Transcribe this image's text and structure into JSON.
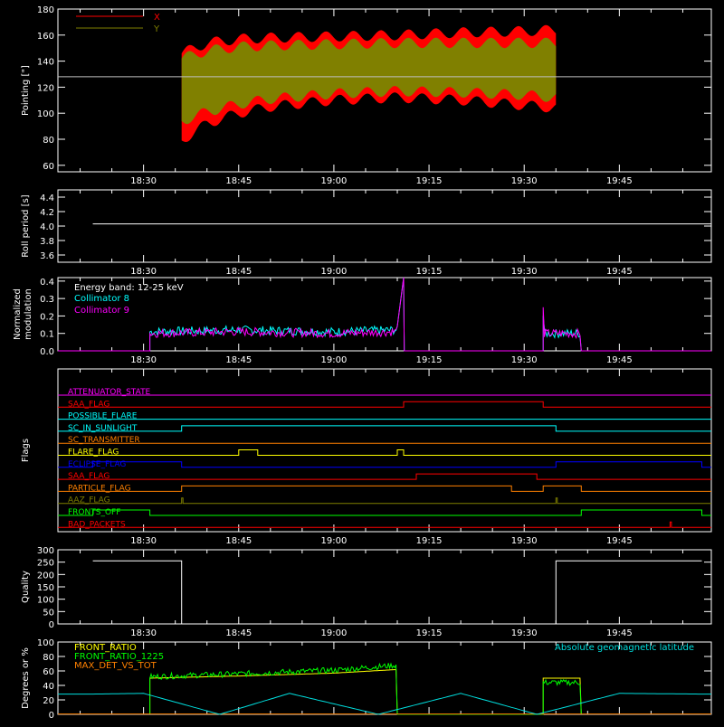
{
  "colors": {
    "background": "#000000",
    "axis": "#ffffff",
    "x_pointing": "#ff0000",
    "y_pointing": "#808000",
    "collimator8": "#00ffff",
    "collimator9": "#ff00ff",
    "front_ratio": "#ffff00",
    "front_ratio_1225": "#00ff00",
    "max_det_vs_tot": "#ff8000",
    "geomag": "#00e0e0"
  },
  "time_axis": {
    "ticks": [
      "18:30",
      "18:45",
      "19:00",
      "19:15",
      "19:30",
      "19:45"
    ],
    "range_minutes_since_midnight": [
      1096.5,
      1199.5
    ],
    "tick_minutes_since_midnight": [
      1110,
      1125,
      1140,
      1155,
      1170,
      1185
    ]
  },
  "chart_data": [
    {
      "id": "pointing",
      "type": "area",
      "ylabel": "Pointing [\"]",
      "ylim": [
        55,
        180
      ],
      "yticks": [
        60,
        80,
        100,
        120,
        140,
        160,
        180
      ],
      "reference_line": 128,
      "legend": [
        "X",
        "Y"
      ],
      "legend_placement": "top-left",
      "data_start": "18:36",
      "data_end": "19:35",
      "series": [
        {
          "name": "X",
          "x": [
            "18:36",
            "18:40",
            "18:45",
            "18:50",
            "19:00",
            "19:10",
            "19:20",
            "19:30",
            "19:35"
          ],
          "min": [
            75,
            88,
            96,
            101,
            106,
            108,
            106,
            102,
            100
          ],
          "max": [
            150,
            158,
            161,
            162,
            163,
            164,
            166,
            167,
            168
          ]
        },
        {
          "name": "Y",
          "x": [
            "18:36",
            "18:40",
            "18:45",
            "18:50",
            "19:00",
            "19:10",
            "19:20",
            "19:30",
            "19:35"
          ],
          "min": [
            90,
            97,
            103,
            107,
            111,
            113,
            112,
            110,
            108
          ],
          "max": [
            146,
            152,
            155,
            156,
            157,
            158,
            158,
            158,
            158
          ]
        }
      ]
    },
    {
      "id": "roll_period",
      "type": "line",
      "ylabel": "Roll period [s]",
      "ylim": [
        3.5,
        4.5
      ],
      "yticks": [
        3.6,
        3.8,
        4.0,
        4.2,
        4.4
      ],
      "series": [
        {
          "name": "",
          "x": [
            "18:22",
            "19:58"
          ],
          "values": [
            4.03,
            4.03
          ]
        }
      ]
    },
    {
      "id": "modulation",
      "type": "line",
      "ylabel": "Normalized modulation",
      "ylim": [
        0,
        0.42
      ],
      "yticks": [
        0.0,
        0.1,
        0.2,
        0.3,
        0.4
      ],
      "annotations": [
        "Energy band: 12-25 keV"
      ],
      "legend": [
        "Collimator 8",
        "Collimator 9"
      ],
      "series": [
        {
          "name": "Collimator 8",
          "x": [
            "18:31",
            "18:45",
            "19:00",
            "19:10",
            "19:11",
            "19:33",
            "19:36",
            "19:39"
          ],
          "values": [
            0.11,
            0.12,
            0.11,
            0.12,
            0.42,
            0.2,
            0.11,
            0.1
          ]
        },
        {
          "name": "Collimator 9",
          "x": [
            "18:31",
            "18:45",
            "19:00",
            "19:10",
            "19:11",
            "19:33",
            "19:36",
            "19:39"
          ],
          "values": [
            0.1,
            0.11,
            0.1,
            0.11,
            0.42,
            0.25,
            0.1,
            0.09
          ]
        }
      ]
    },
    {
      "id": "flags",
      "type": "line",
      "ylabel": "Flags",
      "flags": [
        {
          "name": "ATTENUATOR_STATE",
          "color": "#ff00ff",
          "high": []
        },
        {
          "name": "SAA_FLAG",
          "color": "#ff0000",
          "high": [
            [
              "19:11",
              "19:33"
            ]
          ]
        },
        {
          "name": "POSSIBLE_FLARE",
          "color": "#00ffff",
          "high": []
        },
        {
          "name": "SC_IN_SUNLIGHT",
          "color": "#00ffff",
          "high": [
            [
              "18:36",
              "19:35"
            ]
          ]
        },
        {
          "name": "SC_TRANSMITTER",
          "color": "#ff8000",
          "high": []
        },
        {
          "name": "FLARE_FLAG",
          "color": "#ffff00",
          "high": [
            [
              "18:45",
              "18:48"
            ],
            [
              "19:10",
              "19:11"
            ]
          ]
        },
        {
          "name": "ECLIPSE_FLAG",
          "color": "#0000ff",
          "high": [
            [
              "18:22",
              "18:36"
            ],
            [
              "19:35",
              "19:58"
            ]
          ]
        },
        {
          "name": "SAA_FLAG",
          "color": "#ff0000",
          "high": [
            [
              "19:13",
              "19:32"
            ]
          ]
        },
        {
          "name": "PARTICLE_FLAG",
          "color": "#ff8000",
          "high": [
            [
              "18:36",
              "19:28"
            ],
            [
              "19:33",
              "19:39"
            ]
          ]
        },
        {
          "name": "AAZ_FLAG",
          "color": "#808000",
          "high": [
            [
              "18:36",
              "18:36"
            ],
            [
              "19:35",
              "19:35"
            ]
          ]
        },
        {
          "name": "FRONTS_OFF",
          "color": "#00ff00",
          "high": [
            [
              "18:22",
              "18:31"
            ],
            [
              "19:39",
              "19:58"
            ]
          ]
        },
        {
          "name": "BAD_PACKETS",
          "color": "#ff0000",
          "high": [
            [
              "19:53",
              "19:53"
            ]
          ]
        }
      ]
    },
    {
      "id": "quality",
      "type": "line",
      "ylabel": "Quality",
      "ylim": [
        0,
        300
      ],
      "yticks": [
        0,
        50,
        100,
        150,
        200,
        250,
        300
      ],
      "series": [
        {
          "name": "",
          "x": [
            "18:22",
            "18:36",
            "18:36",
            "19:35",
            "19:35",
            "19:58"
          ],
          "values": [
            255,
            255,
            0,
            0,
            255,
            255
          ]
        }
      ]
    },
    {
      "id": "ratios",
      "type": "line",
      "ylabel": "Degrees or %",
      "ylim": [
        0,
        100
      ],
      "yticks": [
        0,
        20,
        40,
        60,
        80,
        100
      ],
      "annotations": [
        "Absolute geomagnetic latitude"
      ],
      "legend": [
        "FRONT_RATIO",
        "FRONT_RATIO_1225",
        "MAX_DET_VS_TOT"
      ],
      "series": [
        {
          "name": "FRONT_RATIO",
          "x": [
            "18:31",
            "18:45",
            "19:00",
            "19:10",
            "19:33",
            "19:39"
          ],
          "values": [
            50,
            53,
            57,
            62,
            50,
            50
          ]
        },
        {
          "name": "FRONT_RATIO_1225",
          "x": [
            "18:31",
            "18:45",
            "19:00",
            "19:10",
            "19:33",
            "19:39"
          ],
          "values": [
            52,
            56,
            61,
            68,
            44,
            42
          ]
        },
        {
          "name": "MAX_DET_VS_TOT",
          "x": [
            "18:22",
            "19:58"
          ],
          "values": [
            0,
            0
          ]
        },
        {
          "name": "Absolute geomagnetic latitude",
          "x": [
            "18:22",
            "18:30",
            "18:42",
            "18:53",
            "19:07",
            "19:20",
            "19:32",
            "19:45",
            "19:58"
          ],
          "values": [
            28,
            29,
            0,
            29,
            0,
            29,
            0,
            29,
            28
          ]
        }
      ]
    }
  ]
}
